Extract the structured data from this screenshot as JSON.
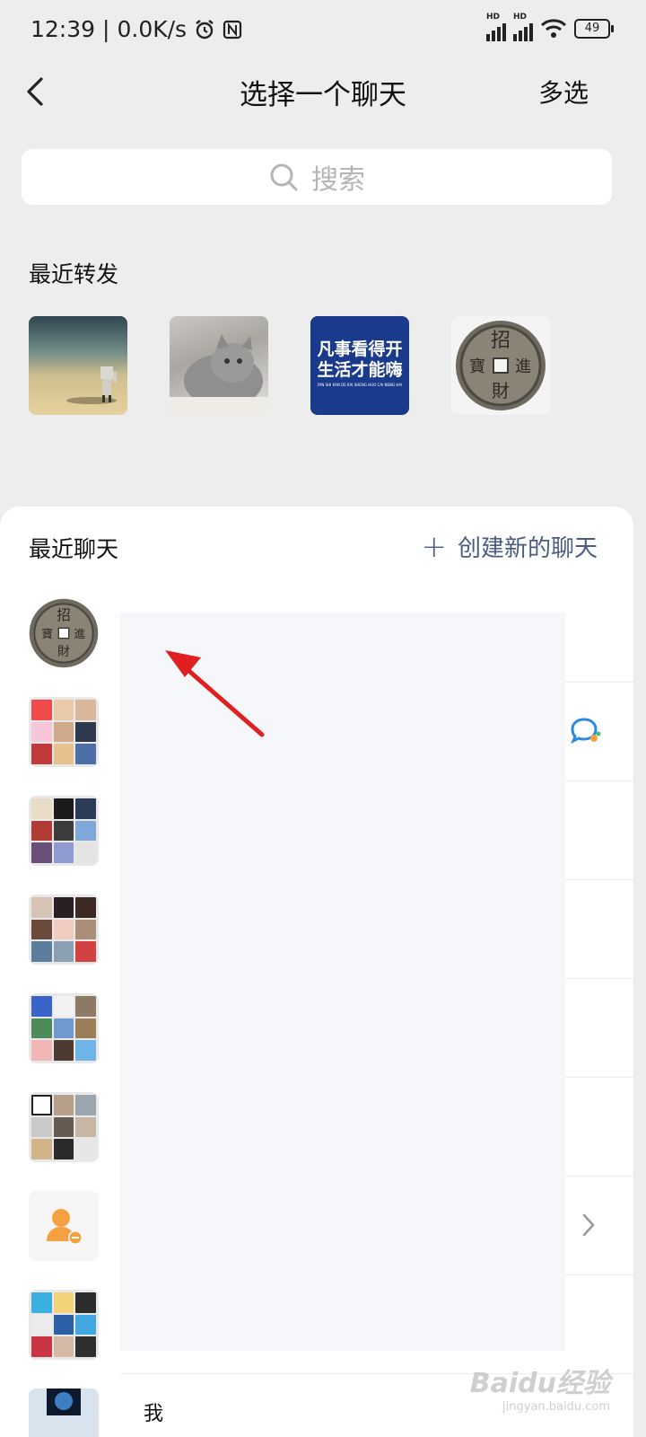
{
  "status": {
    "time": "12:39",
    "speed": "0.0K/s",
    "battery": "49",
    "sig1": "HD",
    "sig2": "HD"
  },
  "header": {
    "title": "选择一个聊天",
    "multi_select": "多选"
  },
  "search": {
    "placeholder": "搜索"
  },
  "recent_forward": {
    "title": "最近转发",
    "poster_line1": "凡事看得开",
    "poster_line2": "生活才能嗨",
    "poster_sub": "FAN SHI KAN DE KAI SHENG HUO CAI NENG HAI",
    "coin_chars": [
      "招",
      "進",
      "財",
      "寶"
    ]
  },
  "recent_chat": {
    "title": "最近聊天",
    "new_chat": "创建新的聊天",
    "row_coin_chars": [
      "招",
      "進",
      "財",
      "寶"
    ],
    "partial_label": "我"
  },
  "watermark": {
    "main": "Baidu经验",
    "sub": "jingyan.baidu.com"
  },
  "colors": {
    "accent": "#4b5c80",
    "sheet_bg": "#ffffff",
    "page_bg": "#ededed",
    "poster_bg": "#1a3a8c",
    "arrow": "#e02020",
    "group_orange": "#f5a142"
  }
}
